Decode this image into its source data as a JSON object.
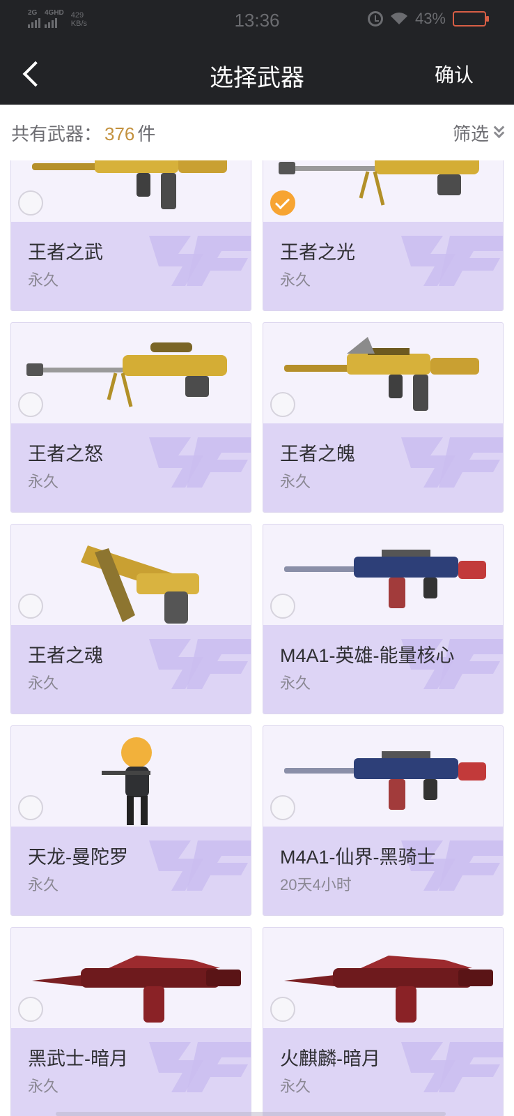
{
  "status_bar": {
    "net1": "2G",
    "net2": "4GHD",
    "speed_value": "429",
    "speed_unit": "KB/s",
    "time": "13:36",
    "battery": "43%"
  },
  "header": {
    "title": "选择武器",
    "confirm_label": "确认"
  },
  "summary": {
    "prefix": "共有武器：",
    "count": "376",
    "suffix": "件",
    "filter_label": "筛选"
  },
  "weapons": [
    {
      "name": "王者之武",
      "duration": "永久",
      "selected": false,
      "image": "gold-rifle-icon"
    },
    {
      "name": "王者之光",
      "duration": "永久",
      "selected": true,
      "image": "gold-sniper-icon"
    },
    {
      "name": "王者之怒",
      "duration": "永久",
      "selected": false,
      "image": "gold-sniper-icon"
    },
    {
      "name": "王者之魄",
      "duration": "永久",
      "selected": false,
      "image": "gold-rifle-icon"
    },
    {
      "name": "王者之魂",
      "duration": "永久",
      "selected": false,
      "image": "gold-pistol-icon"
    },
    {
      "name": "M4A1-英雄-能量核心",
      "duration": "永久",
      "selected": false,
      "image": "blue-rifle-icon"
    },
    {
      "name": "天龙-曼陀罗",
      "duration": "永久",
      "selected": false,
      "image": "character-icon"
    },
    {
      "name": "M4A1-仙界-黑骑士",
      "duration": "20天4小时",
      "selected": false,
      "image": "blue-rifle-icon"
    },
    {
      "name": "黑武士-暗月",
      "duration": "永久",
      "selected": false,
      "image": "red-rifle-icon"
    },
    {
      "name": "火麒麟-暗月",
      "duration": "永久",
      "selected": false,
      "image": "red-rifle-icon"
    }
  ],
  "colors": {
    "bar_bg": "#222326",
    "accent_count": "#c3913e",
    "selected_radio": "#f7a432",
    "card_info_bg": "#ddd4f5"
  }
}
